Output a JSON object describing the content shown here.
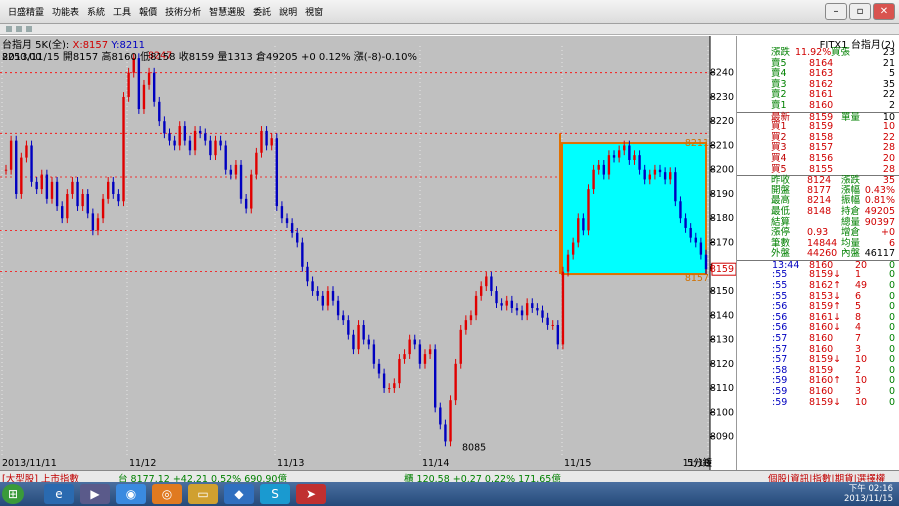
{
  "menu": {
    "items": [
      "日盛精靈",
      "功能表",
      "系統",
      "工具",
      "報價",
      "技術分析",
      "智慧選股",
      "委託",
      "說明",
      "視窗"
    ]
  },
  "chart_header": {
    "symbol_line": "台指月 5K(全):",
    "x_label": "X:8157",
    "y_label": "Y:8211",
    "info_line": "2013/11/15 開8157 高8160 低8158 收8159 量1313 倉49205 +0 0.12% 漲(-8)-0.10%",
    "corner_price": "8250.00"
  },
  "annotations": {
    "high_label": "8247",
    "low_label": "8085",
    "box_top_label": "8211",
    "box_bottom_label": "8157",
    "current_price_tag": "8159",
    "tf_label": "5分鐘"
  },
  "chart_data": {
    "type": "candlestick",
    "ylim": [
      8082,
      8251
    ],
    "yticks": [
      8090,
      8100,
      8110,
      8120,
      8130,
      8140,
      8150,
      8160,
      8170,
      8180,
      8190,
      8200,
      8210,
      8220,
      8230,
      8240
    ],
    "gridlines": [
      8158,
      8175,
      8197,
      8215,
      8240
    ],
    "xlabels": [
      "2013/11/11",
      "11/12",
      "11/13",
      "11/14",
      "11/15",
      "11/18"
    ],
    "close_series": [
      8200,
      8212,
      8190,
      8205,
      8210,
      8195,
      8192,
      8198,
      8188,
      8195,
      8185,
      8180,
      8190,
      8195,
      8185,
      8190,
      8182,
      8175,
      8180,
      8188,
      8195,
      8190,
      8187,
      8230,
      8240,
      8246,
      8225,
      8235,
      8240,
      8228,
      8220,
      8215,
      8212,
      8210,
      8218,
      8212,
      8208,
      8216,
      8215,
      8212,
      8206,
      8212,
      8210,
      8200,
      8198,
      8202,
      8188,
      8184,
      8198,
      8207,
      8216,
      8210,
      8213,
      8185,
      8180,
      8178,
      8174,
      8170,
      8160,
      8154,
      8150,
      8148,
      8144,
      8150,
      8146,
      8140,
      8138,
      8132,
      8126,
      8136,
      8130,
      8128,
      8120,
      8116,
      8110,
      8110,
      8112,
      8122,
      8124,
      8130,
      8128,
      8120,
      8124,
      8126,
      8102,
      8095,
      8088,
      8105,
      8120,
      8134,
      8138,
      8140,
      8148,
      8152,
      8156,
      8150,
      8145,
      8144,
      8146,
      8143,
      8142,
      8140,
      8145,
      8143,
      8142,
      8139,
      8136,
      8136,
      8128,
      8158,
      8165,
      8170,
      8180,
      8175,
      8192,
      8200,
      8202,
      8198,
      8206,
      8205,
      8208,
      8210,
      8204,
      8206,
      8200,
      8196,
      8198,
      8200,
      8199,
      8196,
      8199,
      8187,
      8180,
      8176,
      8172,
      8170,
      8165,
      8159
    ]
  },
  "quote_panel": {
    "title": "FITX1 台指月(2)",
    "change_row": {
      "l1": "漲跌",
      "v1": "11.92%",
      "l2": "買張",
      "v2": "23"
    },
    "ask_rows": [
      {
        "label": "賣5",
        "price": "8164",
        "qty": "21"
      },
      {
        "label": "賣4",
        "price": "8163",
        "qty": "5"
      },
      {
        "label": "賣3",
        "price": "8162",
        "qty": "35"
      },
      {
        "label": "賣2",
        "price": "8161",
        "qty": "22"
      },
      {
        "label": "賣1",
        "price": "8160",
        "qty": "2"
      }
    ],
    "last_row": {
      "label": "最新",
      "price": "8159",
      "label2": "單量",
      "qty": "10"
    },
    "bid_rows": [
      {
        "label": "買1",
        "price": "8159",
        "qty": "10"
      },
      {
        "label": "買2",
        "price": "8158",
        "qty": "22"
      },
      {
        "label": "買3",
        "price": "8157",
        "qty": "28"
      },
      {
        "label": "買4",
        "price": "8156",
        "qty": "20"
      },
      {
        "label": "買5",
        "price": "8155",
        "qty": "28"
      }
    ],
    "stats": [
      {
        "l1": "昨收",
        "v1": "8124",
        "l2": "漲跌",
        "v2": "35"
      },
      {
        "l1": "開盤",
        "v1": "8177",
        "l2": "漲幅",
        "v2": "0.43%"
      },
      {
        "l1": "最高",
        "v1": "8214",
        "l2": "振幅",
        "v2": "0.81%"
      },
      {
        "l1": "最低",
        "v1": "8148",
        "l2": "持倉",
        "v2": "49205"
      },
      {
        "l1": "結算",
        "v1": "",
        "l2": "總量",
        "v2": "90397"
      },
      {
        "l1": "漲停",
        "v1": "0.93",
        "l2": "增倉",
        "v2": "+0"
      },
      {
        "l1": "筆數",
        "v1": "14844",
        "l2": "均量",
        "v2": "6"
      },
      {
        "l1": "外盤",
        "v1": "44260",
        "l2": "內盤",
        "v2": "46117"
      }
    ],
    "ticks": [
      {
        "t": "13:44",
        "p": "8160",
        "q": "20",
        "d": "0"
      },
      {
        "t": ":55",
        "p": "8159↓",
        "q": "1",
        "d": "0"
      },
      {
        "t": ":55",
        "p": "8162↑",
        "q": "49",
        "d": "0"
      },
      {
        "t": ":55",
        "p": "8153↓",
        "q": "6",
        "d": "0"
      },
      {
        "t": ":56",
        "p": "8159↑",
        "q": "5",
        "d": "0"
      },
      {
        "t": ":56",
        "p": "8161↓",
        "q": "8",
        "d": "0"
      },
      {
        "t": ":56",
        "p": "8160↓",
        "q": "4",
        "d": "0"
      },
      {
        "t": ":57",
        "p": "8160",
        "q": "7",
        "d": "0"
      },
      {
        "t": ":57",
        "p": "8160",
        "q": "3",
        "d": "0"
      },
      {
        "t": ":57",
        "p": "8159↓",
        "q": "10",
        "d": "0"
      },
      {
        "t": ":58",
        "p": "8159",
        "q": "2",
        "d": "0"
      },
      {
        "t": ":59",
        "p": "8160↑",
        "q": "10",
        "d": "0"
      },
      {
        "t": ":59",
        "p": "8160",
        "q": "3",
        "d": "0"
      },
      {
        "t": ":59",
        "p": "8159↓",
        "q": "10",
        "d": "0"
      }
    ]
  },
  "bottom_bar": {
    "left": "[大型股] 上市指數",
    "idx1": "台 8177.12 +42.21 0.52% 690.90億",
    "idx2": "櫃 120.58 +0.27 0.22% 171.65億",
    "right": "個股|資訊|指數|期貨|選擇權"
  },
  "taskbar": {
    "clock_top": "下午 02:16",
    "clock_bottom": "2013/11/15"
  },
  "colors": {
    "chart_bg": "#c0c0c0",
    "up": "#e00000",
    "down": "#0000c0",
    "box": "#00ffff",
    "box_border": "#e07000",
    "grid": "#ff0000"
  }
}
